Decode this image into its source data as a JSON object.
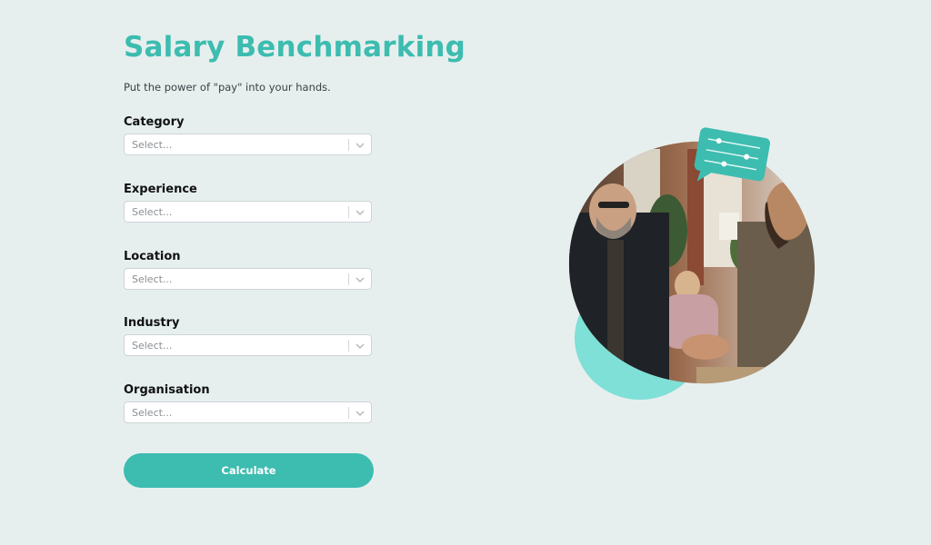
{
  "header": {
    "title": "Salary Benchmarking",
    "subtitle": "Put the power of \"pay\" into your hands."
  },
  "form": {
    "fields": [
      {
        "label": "Category",
        "placeholder": "Select..."
      },
      {
        "label": "Experience",
        "placeholder": "Select..."
      },
      {
        "label": "Location",
        "placeholder": "Select..."
      },
      {
        "label": "Industry",
        "placeholder": "Select..."
      },
      {
        "label": "Organisation",
        "placeholder": "Select..."
      }
    ],
    "submit_label": "Calculate"
  },
  "colors": {
    "accent": "#3dbcb0",
    "accent_light": "#7fe0d7",
    "background": "#e6efee"
  },
  "illustration": {
    "icon": "sliders-chat-bubble-icon",
    "photo": "handshake-photo"
  }
}
